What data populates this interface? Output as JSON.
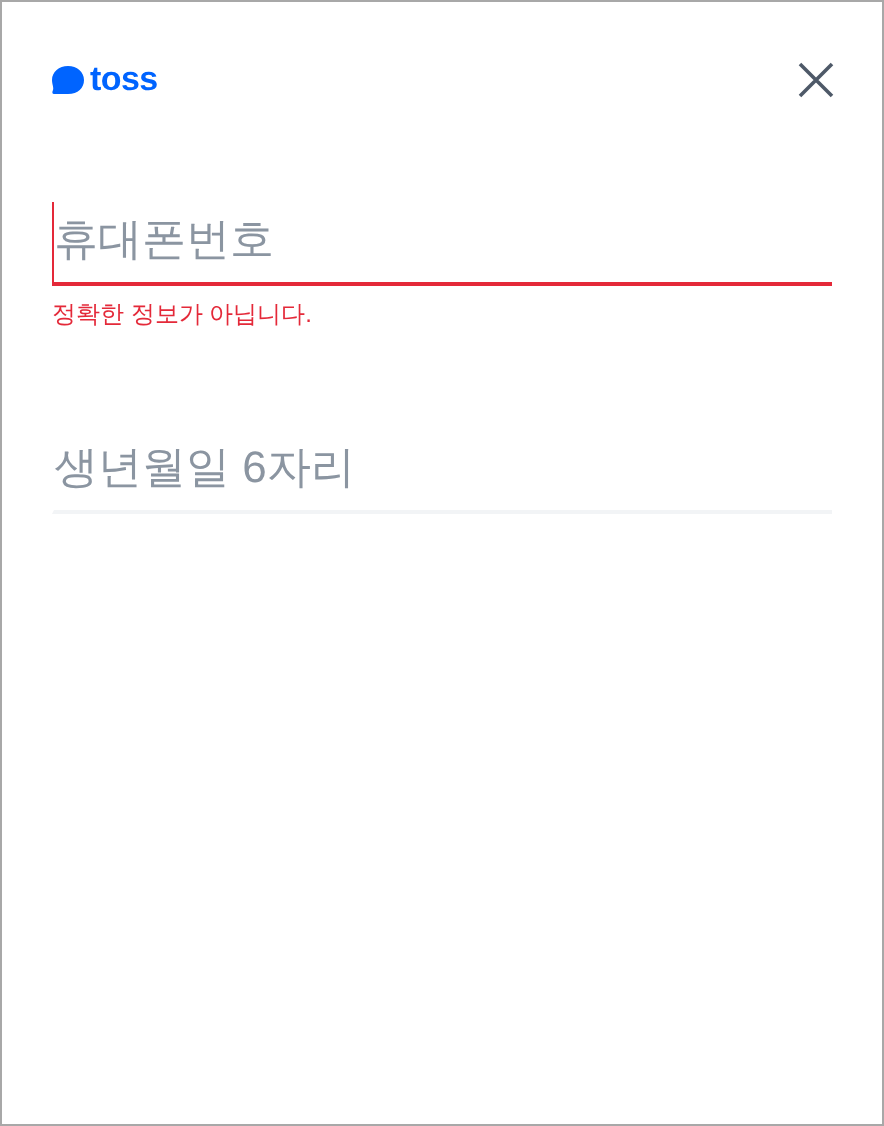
{
  "header": {
    "logo": "toss"
  },
  "fields": [
    {
      "placeholder": "휴대폰번호",
      "focused": true,
      "error": true,
      "error_message": "정확한 정보가 아닙니다."
    },
    {
      "placeholder": "생년월일 6자리",
      "focused": false,
      "error": false
    }
  ]
}
